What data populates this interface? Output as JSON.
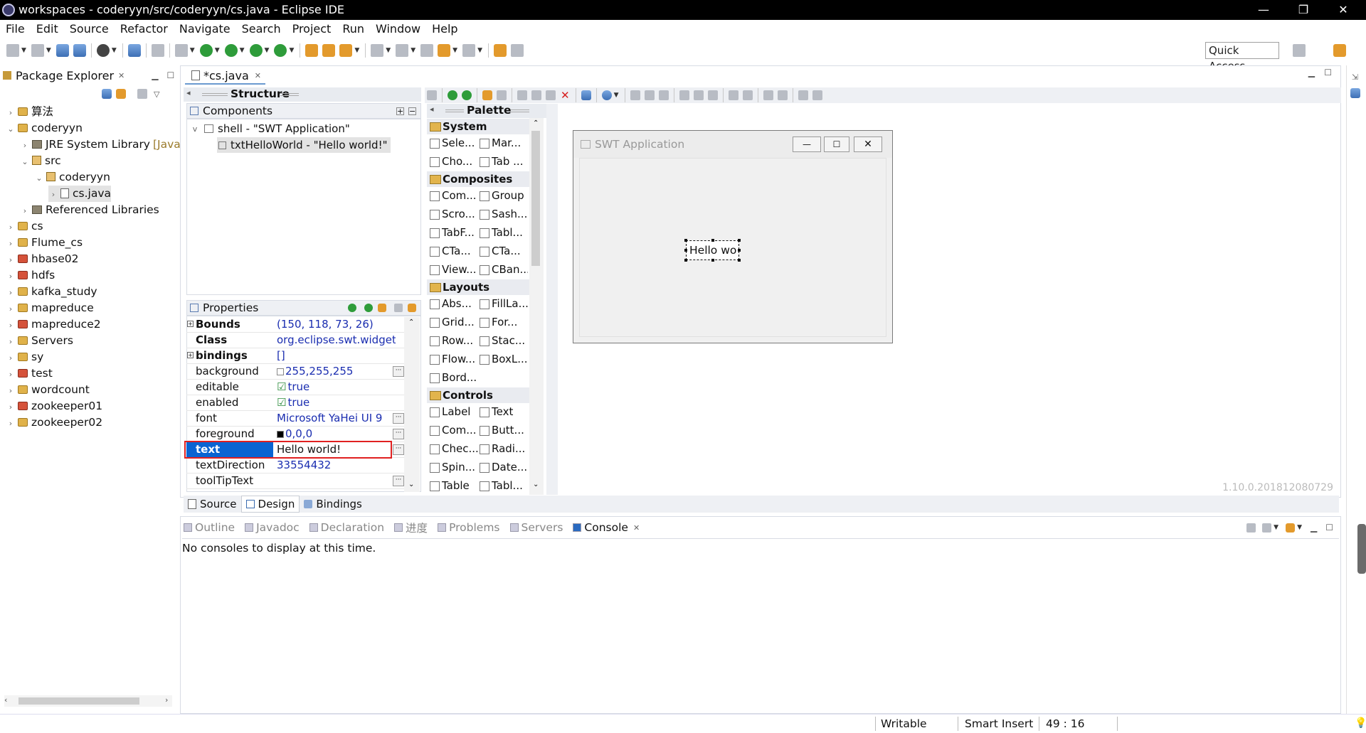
{
  "window": {
    "title": "workspaces - coderyyn/src/coderyyn/cs.java - Eclipse IDE"
  },
  "menu": [
    "File",
    "Edit",
    "Source",
    "Refactor",
    "Navigate",
    "Search",
    "Project",
    "Run",
    "Window",
    "Help"
  ],
  "quick_access": "Quick Access",
  "package_explorer": {
    "title": "Package Explorer",
    "items": [
      {
        "label": "算法",
        "arrow": ">",
        "level": 0,
        "icon": "project-icon"
      },
      {
        "label": "coderyyn",
        "arrow": "v",
        "level": 0,
        "icon": "project-icon"
      },
      {
        "label": "JRE System Library",
        "suffix": "[JavaS",
        "arrow": ">",
        "level": 1,
        "icon": "library-icon"
      },
      {
        "label": "src",
        "arrow": "v",
        "level": 1,
        "icon": "source-folder-icon"
      },
      {
        "label": "coderyyn",
        "arrow": "v",
        "level": 2,
        "icon": "package-icon"
      },
      {
        "label": "cs.java",
        "arrow": ">",
        "level": 3,
        "icon": "java-file-icon"
      },
      {
        "label": "Referenced Libraries",
        "arrow": ">",
        "level": 1,
        "icon": "library-icon"
      },
      {
        "label": "cs",
        "arrow": ">",
        "level": 0,
        "icon": "project-icon"
      },
      {
        "label": "Flume_cs",
        "arrow": ">",
        "level": 0,
        "icon": "project-icon"
      },
      {
        "label": "hbase02",
        "arrow": ">",
        "level": 0,
        "icon": "project-icon-red"
      },
      {
        "label": "hdfs",
        "arrow": ">",
        "level": 0,
        "icon": "project-icon-red"
      },
      {
        "label": "kafka_study",
        "arrow": ">",
        "level": 0,
        "icon": "project-icon"
      },
      {
        "label": "mapreduce",
        "arrow": ">",
        "level": 0,
        "icon": "project-icon"
      },
      {
        "label": "mapreduce2",
        "arrow": ">",
        "level": 0,
        "icon": "project-icon-red"
      },
      {
        "label": "Servers",
        "arrow": ">",
        "level": 0,
        "icon": "project-icon"
      },
      {
        "label": "sy",
        "arrow": ">",
        "level": 0,
        "icon": "project-icon"
      },
      {
        "label": "test",
        "arrow": ">",
        "level": 0,
        "icon": "project-icon-red"
      },
      {
        "label": "wordcount",
        "arrow": ">",
        "level": 0,
        "icon": "project-icon"
      },
      {
        "label": "zookeeper01",
        "arrow": ">",
        "level": 0,
        "icon": "project-icon-red"
      },
      {
        "label": "zookeeper02",
        "arrow": ">",
        "level": 0,
        "icon": "project-icon"
      }
    ]
  },
  "editor": {
    "tab": "*cs.java",
    "structure": {
      "title": "Structure",
      "components_title": "Components",
      "tree": [
        "shell - \"SWT Application\"",
        "txtHelloWorld - \"Hello world!\""
      ]
    },
    "properties": {
      "title": "Properties",
      "rows": [
        {
          "name": "Bounds",
          "value": "(150, 118, 73, 26)",
          "bold": true,
          "expand": true
        },
        {
          "name": "Class",
          "value": "org.eclipse.swt.widget...",
          "bold": true
        },
        {
          "name": "bindings",
          "value": "[]",
          "bold": true,
          "expand": true
        },
        {
          "name": "background",
          "value": "255,255,255",
          "more": true,
          "swatch": "#ffffff"
        },
        {
          "name": "editable",
          "value": "true",
          "check": true
        },
        {
          "name": "enabled",
          "value": "true",
          "check": true
        },
        {
          "name": "font",
          "value": "Microsoft YaHei UI 9",
          "more": true
        },
        {
          "name": "foreground",
          "value": "0,0,0",
          "more": true,
          "swatch": "#000000"
        },
        {
          "name": "text",
          "value": "Hello world!",
          "more": true,
          "selected": true
        },
        {
          "name": "textDirection",
          "value": "33554432"
        },
        {
          "name": "toolTipText",
          "value": "",
          "more": true
        }
      ]
    },
    "palette": {
      "title": "Palette",
      "categories": [
        {
          "name": "System",
          "items": [
            "Sele...",
            "Mar...",
            "Cho...",
            "Tab ..."
          ]
        },
        {
          "name": "Composites",
          "items": [
            "Com...",
            "Group",
            "Scro...",
            "Sash...",
            "TabF...",
            "Tabl...",
            "CTa...",
            "CTa...",
            "View...",
            "CBan..."
          ]
        },
        {
          "name": "Layouts",
          "items": [
            "Abs...",
            "FillLa...",
            "Grid...",
            "For...",
            "Row...",
            "Stac...",
            "Flow...",
            "BoxL...",
            "Bord..."
          ]
        },
        {
          "name": "Controls",
          "items": [
            "Label",
            "Text",
            "Com...",
            "Butt...",
            "Chec...",
            "Radi...",
            "Spin...",
            "Date...",
            "Table",
            "Tabl..."
          ]
        }
      ]
    },
    "canvas": {
      "window_title": "SWT Application",
      "text_widget": "Hello wo",
      "version": "1.10.0.201812080729"
    },
    "bottom_tabs": [
      "Source",
      "Design",
      "Bindings"
    ]
  },
  "bottom_panel": {
    "tabs": [
      "Outline",
      "Javadoc",
      "Declaration",
      "进度",
      "Problems",
      "Servers",
      "Console"
    ],
    "active": "Console",
    "message": "No consoles to display at this time."
  },
  "status": {
    "writable": "Writable",
    "insert": "Smart Insert",
    "position": "49 : 16"
  },
  "colors": {
    "selection": "#0a64d2",
    "highlight_border": "#e02020",
    "link_blue": "#1a2db0"
  }
}
